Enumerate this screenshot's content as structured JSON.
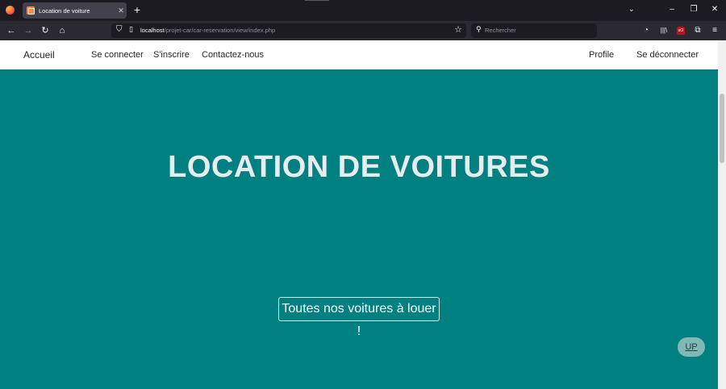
{
  "browser": {
    "tab_title": "Location de voiture",
    "tab_close": "✕",
    "new_tab": "+",
    "tabs_list": "⌄",
    "minimize": "–",
    "restore": "❐",
    "close": "✕",
    "back": "←",
    "forward": "→",
    "reload": "↻",
    "home": "⌂",
    "url_host": "localhost",
    "url_path": "/projet-car/car-reservation/view/index.php",
    "bookmark_star": "☆",
    "search_placeholder": "Rechercher",
    "pocket": "◔",
    "library": "|||\\",
    "ublock": "uO",
    "extensions": "⧉",
    "menu": "≡"
  },
  "site_nav": {
    "brand": "Accueil",
    "links": [
      "Se connecter",
      "S'inscrire",
      "Contactez-nous"
    ],
    "right_links": [
      "Profile",
      "Se déconnecter"
    ]
  },
  "hero": {
    "title": "LOCATION DE VOITURES",
    "cta_label": "Toutes nos voitures à louer !"
  },
  "up_button": "UP",
  "colors": {
    "hero_background": "#008080",
    "nav_background": "#ffffff",
    "up_button": "#80b8b8"
  }
}
